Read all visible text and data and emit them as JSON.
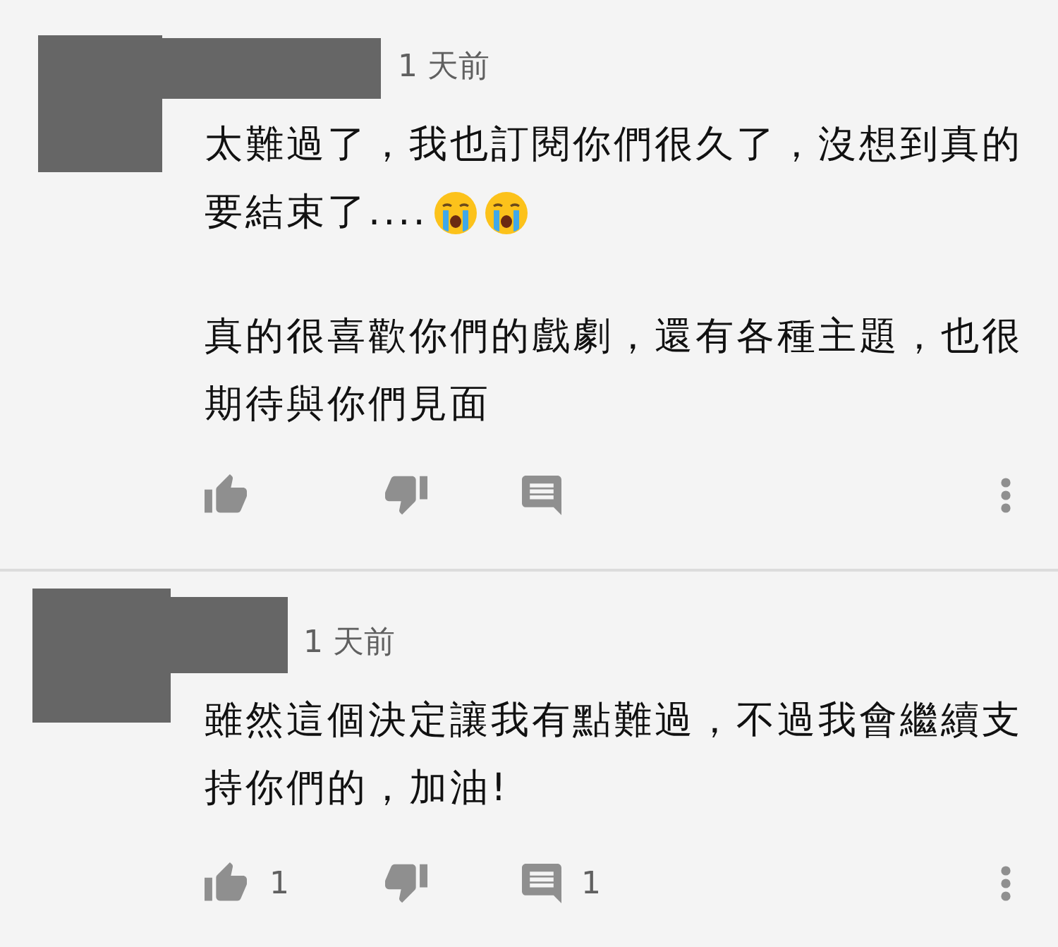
{
  "comments": [
    {
      "time": "1 天前",
      "paragraphs": [
        {
          "lines": [
            "太難過了，我也訂閱你們很久了，沒想到真的",
            "要結束了...."
          ],
          "emojis": [
            {
              "kind": "crying_face"
            },
            {
              "kind": "crying_face"
            }
          ]
        },
        {
          "lines": [
            "真的很喜歡你們的戲劇，還有各種主題，也很",
            "期待與你們見面"
          ]
        }
      ]
    },
    {
      "time": "1 天前",
      "paragraphs": [
        {
          "lines": [
            "雖然這個決定讓我有點難過，不過我會繼續支",
            "持你們的，加油!"
          ]
        }
      ],
      "actions": {
        "like_count": "1",
        "reply_count": "1"
      }
    }
  ]
}
